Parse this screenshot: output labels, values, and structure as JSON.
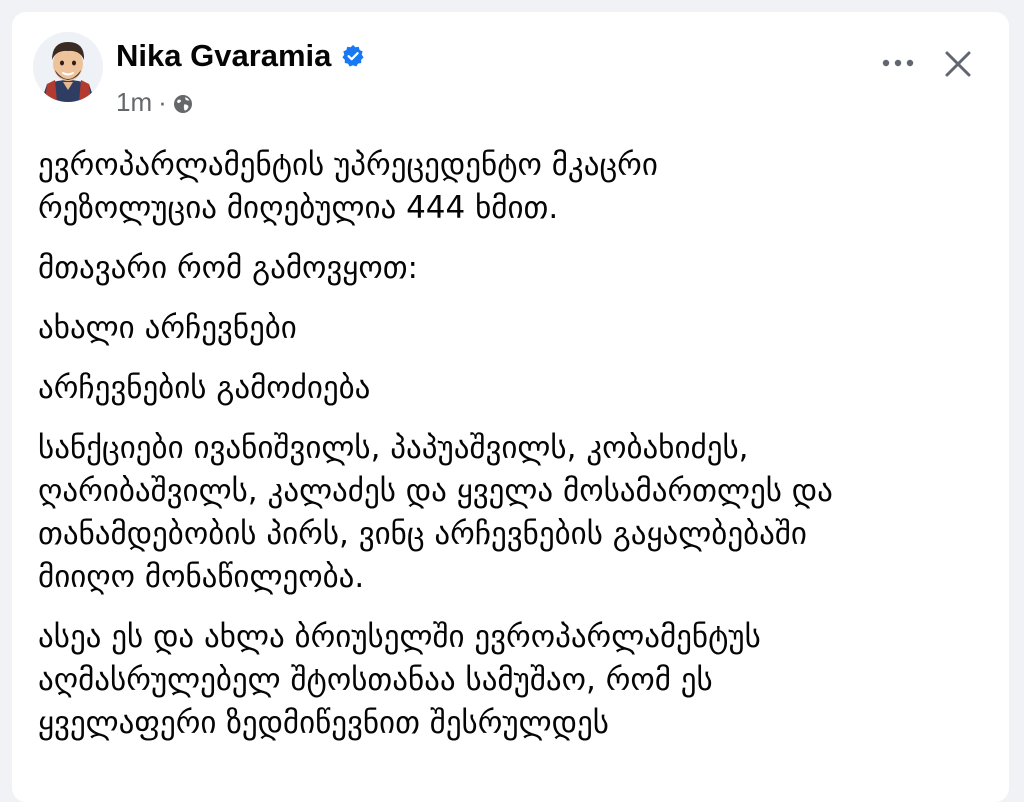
{
  "post": {
    "author": "Nika Gvaramia",
    "time": "1m",
    "separator": "·",
    "lines": [
      "ევროპარლამენტის უპრეცედენტო მკაცრი",
      "რეზოლუცია მიღებულია 444 ხმით.",
      "მთავარი რომ გამოვყოთ:",
      "ახალი არჩევნები",
      "არჩევნების გამოძიება",
      "სანქციები ივანიშვილს, პაპუაშვილს, კობახიძეს,",
      "ღარიბაშვილს, კალაძეს და ყველა მოსამართლეს და",
      "თანამდებობის პირს, ვინც არჩევნების გაყალბებაში",
      "მიიღო მონაწილეობა.",
      "ასეა ეს და ახლა ბრიუსელში ევროპარლამენტუს",
      "აღმასრულებელ შტოსთანაა სამუშაო, რომ ეს",
      "ყველაფერი ზედმიწევნით შესრულდეს"
    ]
  },
  "icons": {
    "verified": "verified-badge-icon",
    "audience": "globe-icon",
    "more": "more-options-icon",
    "close": "close-icon"
  },
  "colors": {
    "background": "#f0f2f5",
    "card": "#ffffff",
    "text": "#050505",
    "secondary_text": "#65676b",
    "verified_blue": "#1877f2"
  }
}
